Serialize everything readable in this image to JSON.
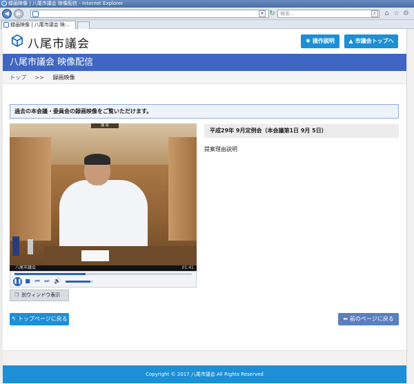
{
  "browser": {
    "window_title": "録画映像 | 八尾市議会 映像配信 - Internet Explorer",
    "search_placeholder": "検索...",
    "tab_label": "録画映像 | 八尾市議会 映..."
  },
  "header": {
    "logo_text": "八尾市議会",
    "help_button": "操作説明",
    "council_top_button": "市議会トップへ"
  },
  "banner": {
    "title": "八尾市議会  映像配信"
  },
  "breadcrumb": {
    "home": "トップ",
    "separator": ">>",
    "current": "録画映像"
  },
  "notice": "過去の本会議・委員会の録画映像をご覧いただけます。",
  "video": {
    "nameplate": "議 長",
    "caption": "八尾市議会",
    "time": "01:41",
    "progress": 0.4,
    "volume": 0.9
  },
  "popout_button": "別ウィンドウ表示",
  "session": {
    "title": "平成29年 9月定例会（本会議第1日 9月 5日）",
    "agenda": "提案理由説明"
  },
  "nav": {
    "top_page": "トップページに戻る",
    "prev_page": "前のページに戻る"
  },
  "footer": {
    "copyright": "Copyright © 2017 八尾市議会 All Rights Reserved"
  },
  "colors": {
    "accent": "#1c8fd6",
    "banner": "#3f66c4",
    "prev_button": "#5a7fc0"
  }
}
